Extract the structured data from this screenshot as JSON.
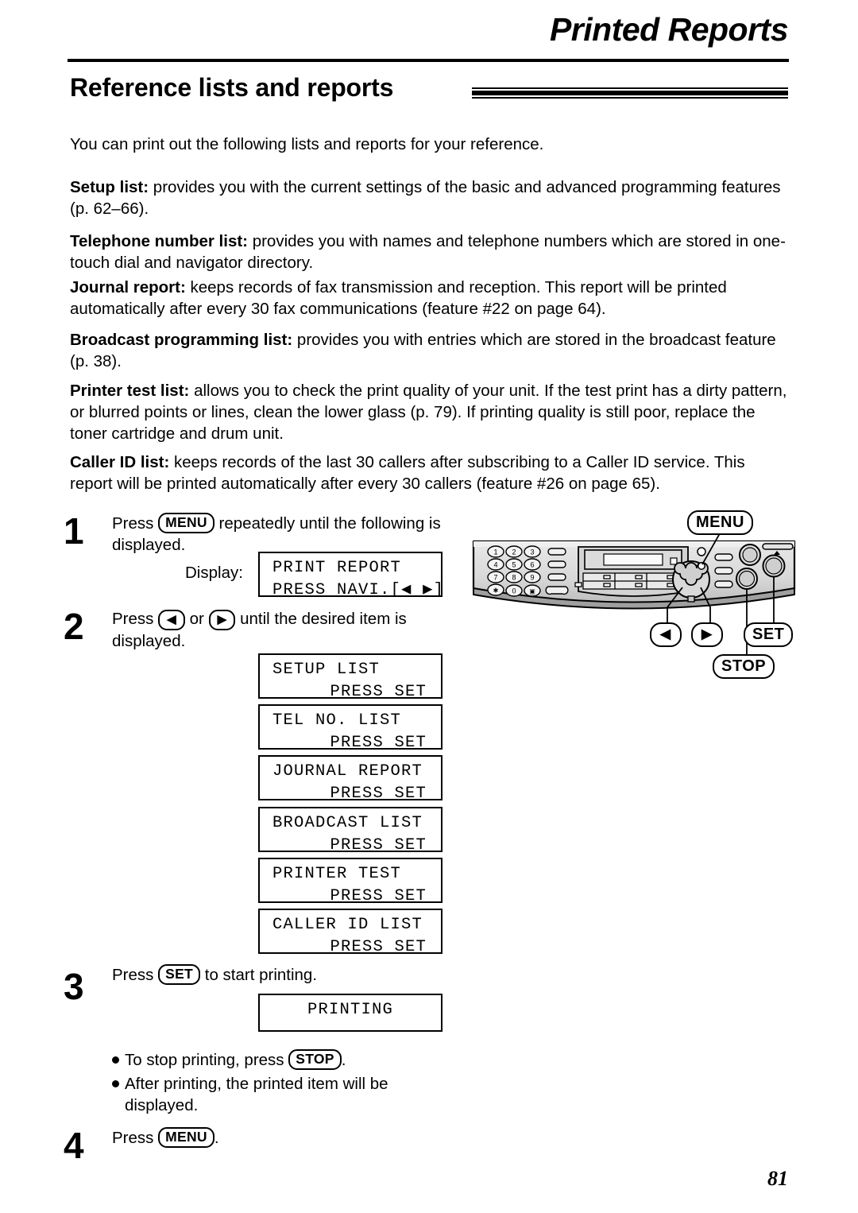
{
  "header": {
    "chapter_title": "Printed Reports",
    "section_title": "Reference lists and reports"
  },
  "intro": "You can print out the following lists and reports for your reference.",
  "definitions": [
    {
      "term": "Setup list:",
      "text": " provides you with the current settings of the basic and advanced programming features (p. 62–66)."
    },
    {
      "term": "Telephone number list:",
      "text": " provides you with names and telephone numbers which are stored in one-touch dial and navigator directory."
    },
    {
      "term": "Journal report:",
      "text": " keeps records of fax transmission and reception. This report will be printed automatically after every 30 fax communications (feature #22 on page 64)."
    },
    {
      "term": "Broadcast programming list:",
      "text": " provides you with entries which are stored in the broadcast feature (p. 38)."
    },
    {
      "term": "Printer test list:",
      "text": " allows you to check the print quality of your unit. If the test print has a dirty pattern, or blurred points or lines, clean the lower glass (p. 79). If printing quality is still poor, replace the toner cartridge and drum unit."
    },
    {
      "term": "Caller ID list:",
      "text": " keeps records of the last 30 callers after subscribing to a Caller ID service. This report will be printed automatically after every 30 callers (feature #26 on page 65)."
    }
  ],
  "steps": {
    "one": {
      "number": "1",
      "pre": "Press ",
      "key": "MENU",
      "post": " repeatedly until the following is displayed.",
      "display_label": "Display:"
    },
    "two": {
      "number": "2",
      "pre": "Press ",
      "key_left": "◀",
      "mid": " or ",
      "key_right": "▶",
      "post": " until the desired item is displayed."
    },
    "three": {
      "number": "3",
      "pre": "Press ",
      "key": "SET",
      "post": " to start printing."
    },
    "four": {
      "number": "4",
      "pre": "Press ",
      "key": "MENU",
      "post": "."
    }
  },
  "lcd_screens": {
    "print_report": {
      "line1": "PRINT REPORT",
      "line2": "PRESS NAVI.[◀ ▶]"
    },
    "items": [
      {
        "line1": "SETUP LIST",
        "line2": "PRESS SET"
      },
      {
        "line1": "TEL NO. LIST",
        "line2": "PRESS SET"
      },
      {
        "line1": "JOURNAL REPORT",
        "line2": "PRESS SET"
      },
      {
        "line1": "BROADCAST LIST",
        "line2": "PRESS SET"
      },
      {
        "line1": "PRINTER TEST",
        "line2": "PRESS SET"
      },
      {
        "line1": "CALLER ID LIST",
        "line2": "PRESS SET"
      }
    ],
    "printing": {
      "line1": "PRINTING",
      "line2": ""
    }
  },
  "notes": [
    {
      "pre": "To stop printing, press ",
      "key": "STOP",
      "post": "."
    },
    {
      "pre": "After printing, the printed item will be displayed.",
      "key": "",
      "post": ""
    }
  ],
  "device": {
    "callouts": {
      "menu": "MENU",
      "left_arrow": "◀",
      "right_arrow": "▶",
      "set": "SET",
      "stop": "STOP"
    },
    "keypad": [
      "1",
      "2",
      "3",
      "4",
      "5",
      "6",
      "7",
      "8",
      "9",
      "✳",
      "0",
      "⌗"
    ]
  },
  "footer": {
    "page_number": "81"
  },
  "colors": {
    "ink": "#000000",
    "paper": "#ffffff",
    "panel_light": "#e3e3e3",
    "panel_mid": "#cfcfcf",
    "panel_dark": "#b4b4b4"
  }
}
